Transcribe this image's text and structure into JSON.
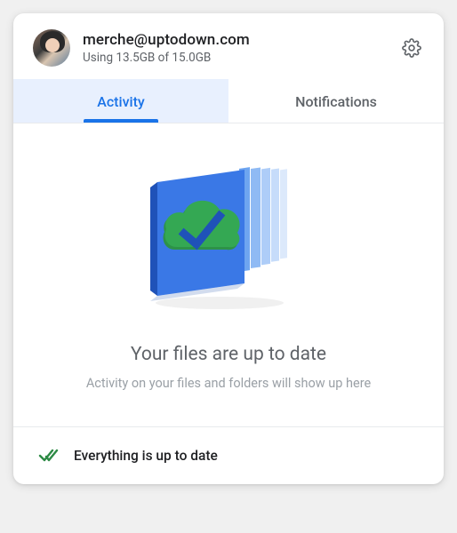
{
  "header": {
    "email": "merche@uptodown.com",
    "storage": "Using 13.5GB of 15.0GB"
  },
  "tabs": {
    "activity": "Activity",
    "notifications": "Notifications"
  },
  "content": {
    "heading": "Your files are up to date",
    "subtext": "Activity on your files and folders will show up here"
  },
  "footer": {
    "status": "Everything is up to date"
  },
  "colors": {
    "accent": "#1a73e8",
    "green": "#34a853"
  }
}
